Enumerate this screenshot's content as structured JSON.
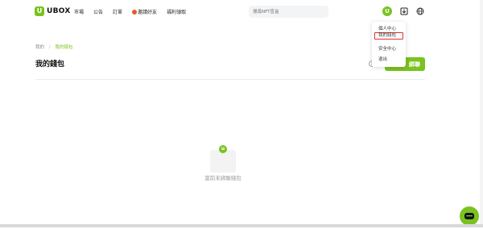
{
  "brand": {
    "logo_letter": "U",
    "name": "UBOX",
    "accent": "#7ac21f"
  },
  "nav": {
    "links": [
      "市場",
      "公告",
      "訂單",
      "邀請好友",
      "福利領取"
    ],
    "search_placeholder": "搜尋NFT盲盒"
  },
  "user_menu": {
    "avatar_letter": "U",
    "items": [
      "個人中心",
      "我的錢包",
      "安全中心",
      "退出"
    ],
    "selected_index": 1
  },
  "page": {
    "breadcrumb": [
      "我的",
      "我的錢包"
    ],
    "title": "我的錢包",
    "action_button": "綁聯"
  },
  "empty_state": {
    "badge_letter": "u",
    "message": "當前未綁聯錢包"
  }
}
